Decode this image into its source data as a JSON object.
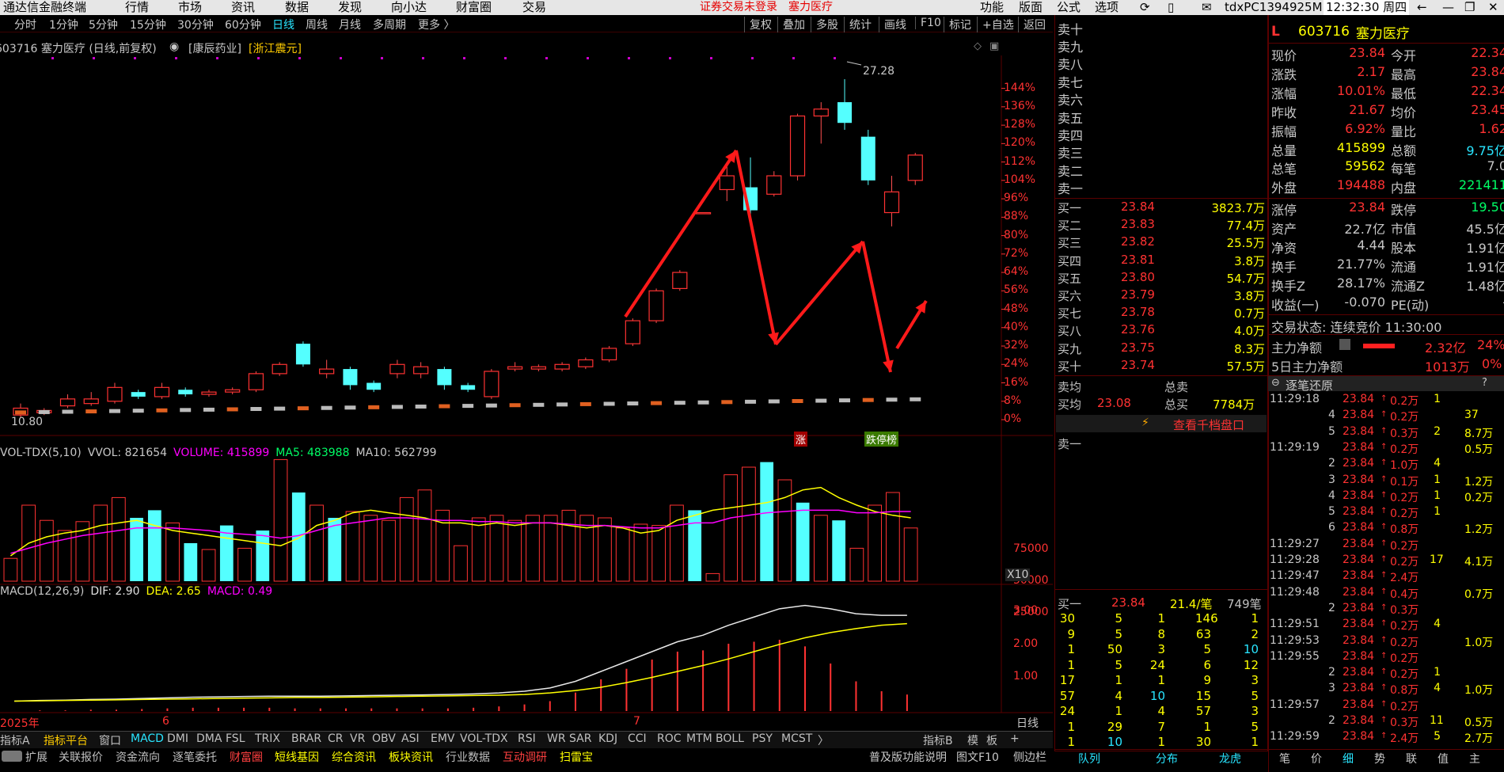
{
  "window": {
    "app_title": "通达信金融终端",
    "menu": [
      "行情",
      "市场",
      "资讯",
      "数据",
      "发现",
      "向小达",
      "财富圈",
      "交易"
    ],
    "notice": "证券交易未登录",
    "notice_stock": "塞力医疗",
    "right_menu": [
      "功能",
      "版面",
      "公式",
      "选项"
    ],
    "user": "tdxPC1394925M",
    "clock": "12:32:30 周四"
  },
  "period_tabs": [
    "分时",
    "1分钟",
    "5分钟",
    "15分钟",
    "30分钟",
    "60分钟",
    "日线",
    "周线",
    "月线",
    "多周期",
    "更多 〉"
  ],
  "active_period": "日线",
  "chart_tools": [
    "复权",
    "叠加",
    "多股",
    "统计",
    "画线",
    "F10",
    "标记",
    "+自选",
    "返回"
  ],
  "chart_header": {
    "code_title": "603716 塞力医疗 (日线,前复权)",
    "concept": "[康辰药业]",
    "region": "[浙江震元]"
  },
  "kline_chart": {
    "high_label": "27.28",
    "low_label": "10.80",
    "y_ticks": [
      "144%",
      "136%",
      "128%",
      "120%",
      "112%",
      "104%",
      "96%",
      "88%",
      "80%",
      "72%",
      "64%",
      "56%",
      "48%",
      "40%",
      "32%",
      "24%",
      "16%",
      "8%",
      "0%"
    ],
    "zhang_label": "涨",
    "diebang_label": "跌",
    "cibang_label": "榜",
    "limit_label": "跌停榜"
  },
  "chart_data": [
    {
      "type": "candlestick",
      "title": "603716 塞力医疗 (日线,前复权)",
      "ylabel": "",
      "y_unit": "% from base",
      "ylim": [
        0,
        148
      ],
      "grid": true,
      "series": [
        {
          "name": "",
          "values": [
            {
              "o": 2,
              "c": 5,
              "h": 7,
              "l": 1,
              "up": true
            },
            {
              "o": 3,
              "c": 4,
              "h": 5,
              "l": 2,
              "up": true
            },
            {
              "o": 6,
              "c": 9,
              "h": 11,
              "l": 5,
              "up": true
            },
            {
              "o": 7,
              "c": 9,
              "h": 12,
              "l": 6,
              "up": true
            },
            {
              "o": 8,
              "c": 14,
              "h": 16,
              "l": 7,
              "up": true
            },
            {
              "o": 12,
              "c": 10,
              "h": 13,
              "l": 9,
              "up": false
            },
            {
              "o": 10,
              "c": 14,
              "h": 16,
              "l": 9,
              "up": true
            },
            {
              "o": 13,
              "c": 11,
              "h": 14,
              "l": 10,
              "up": false
            },
            {
              "o": 11,
              "c": 12,
              "h": 13,
              "l": 10,
              "up": true
            },
            {
              "o": 12,
              "c": 13,
              "h": 14,
              "l": 11,
              "up": true
            },
            {
              "o": 13,
              "c": 20,
              "h": 21,
              "l": 12,
              "up": true
            },
            {
              "o": 20,
              "c": 24,
              "h": 25,
              "l": 19,
              "up": true
            },
            {
              "o": 33,
              "c": 24,
              "h": 34,
              "l": 23,
              "up": false
            },
            {
              "o": 22,
              "c": 20,
              "h": 26,
              "l": 18,
              "up": true
            },
            {
              "o": 22,
              "c": 15,
              "h": 23,
              "l": 13,
              "up": false
            },
            {
              "o": 16,
              "c": 13,
              "h": 17,
              "l": 12,
              "up": false
            },
            {
              "o": 20,
              "c": 24,
              "h": 26,
              "l": 18,
              "up": true
            },
            {
              "o": 20,
              "c": 23,
              "h": 25,
              "l": 18,
              "up": true
            },
            {
              "o": 22,
              "c": 15,
              "h": 23,
              "l": 13,
              "up": false
            },
            {
              "o": 15,
              "c": 13,
              "h": 16,
              "l": 12,
              "up": false
            },
            {
              "o": 10,
              "c": 21,
              "h": 22,
              "l": 9,
              "up": true
            },
            {
              "o": 22,
              "c": 23,
              "h": 25,
              "l": 21,
              "up": true
            },
            {
              "o": 22,
              "c": 23,
              "h": 24,
              "l": 21,
              "up": true
            },
            {
              "o": 22,
              "c": 24,
              "h": 25,
              "l": 21,
              "up": true
            },
            {
              "o": 23,
              "c": 26,
              "h": 27,
              "l": 22,
              "up": true
            },
            {
              "o": 26,
              "c": 31,
              "h": 32,
              "l": 25,
              "up": true
            },
            {
              "o": 33,
              "c": 43,
              "h": 44,
              "l": 32,
              "up": true
            },
            {
              "o": 43,
              "c": 56,
              "h": 57,
              "l": 42,
              "up": true
            },
            {
              "o": 57,
              "c": 64,
              "h": 65,
              "l": 56,
              "up": true
            },
            {
              "o": 90,
              "c": 90,
              "h": 90,
              "l": 90,
              "up": true
            },
            {
              "o": 100,
              "c": 106,
              "h": 112,
              "l": 95,
              "up": true
            },
            {
              "o": 101,
              "c": 91,
              "h": 114,
              "l": 88,
              "up": false
            },
            {
              "o": 98,
              "c": 106,
              "h": 108,
              "l": 97,
              "up": true
            },
            {
              "o": 106,
              "c": 132,
              "h": 133,
              "l": 104,
              "up": true
            },
            {
              "o": 132,
              "c": 135,
              "h": 138,
              "l": 120,
              "up": true
            },
            {
              "o": 138,
              "c": 129,
              "h": 148,
              "l": 126,
              "up": false
            },
            {
              "o": 123,
              "c": 104,
              "h": 126,
              "l": 102,
              "up": false
            },
            {
              "o": 90,
              "c": 99,
              "h": 106,
              "l": 84,
              "up": true
            },
            {
              "o": 104,
              "c": 115,
              "h": 116,
              "l": 102,
              "up": true
            }
          ]
        }
      ]
    },
    {
      "type": "bar",
      "title": "VOL-TDX(5,10)",
      "ylabel": "",
      "ylim": [
        0,
        100000
      ],
      "unit_label": "X10",
      "y_ticks": [
        25000,
        50000,
        75000
      ],
      "series": [
        {
          "name": "VOLUME",
          "values": [
            18000,
            60000,
            48000,
            40000,
            47000,
            60000,
            66000,
            50000,
            56000,
            46000,
            30000,
            25000,
            44000,
            26000,
            40000,
            96000,
            70000,
            60000,
            50000,
            55000,
            52000,
            48000,
            66000,
            72000,
            56000,
            28000,
            50000,
            52000,
            48000,
            52000,
            52000,
            56000,
            52000,
            50000,
            42000,
            45000,
            44000,
            60000,
            56000,
            6000,
            84000,
            90000,
            94000,
            80000,
            62000,
            52000,
            48000,
            26000,
            60000,
            70000,
            42000
          ]
        },
        {
          "name": "MA5",
          "values": [
            20000,
            30000,
            35000,
            38000,
            40000,
            44000,
            46000,
            48000,
            44000,
            40000,
            38000,
            36000,
            34000,
            32000,
            30000,
            28000,
            34000,
            44000,
            48000,
            54000,
            56000,
            54000,
            52000,
            50000,
            46000,
            46000,
            44000,
            46000,
            44000,
            46000,
            46000,
            44000,
            42000,
            44000,
            42000,
            38000,
            40000,
            48000,
            52000,
            56000,
            58000,
            60000,
            62000,
            66000,
            72000,
            74000,
            66000,
            60000,
            55000,
            52000,
            50000
          ]
        },
        {
          "name": "MA10",
          "values": [
            22000,
            26000,
            30000,
            33000,
            36000,
            38000,
            40000,
            42000,
            42000,
            42000,
            41000,
            40000,
            38000,
            37000,
            36000,
            34000,
            36000,
            40000,
            44000,
            46000,
            48000,
            50000,
            50000,
            49000,
            48000,
            48000,
            47000,
            47000,
            46000,
            46000,
            46000,
            45000,
            44000,
            44000,
            43000,
            42000,
            42000,
            44000,
            46000,
            46000,
            50000,
            52000,
            54000,
            55000,
            56000,
            56000,
            56000,
            54000,
            54000,
            55000,
            55000
          ]
        }
      ],
      "legend": {
        "vvol": "VVOL: 821654",
        "volume": "VOLUME: 415899",
        "ma5": "MA5: 483988",
        "ma10": "MA10: 562799"
      }
    },
    {
      "type": "line",
      "title": "MACD(12,26,9)",
      "ylabel": "",
      "ylim": [
        0,
        3.6
      ],
      "y_ticks": [
        1.0,
        2.0,
        3.0
      ],
      "series": [
        {
          "name": "DIF",
          "values": [
            0.3,
            0.32,
            0.33,
            0.35,
            0.36,
            0.38,
            0.4,
            0.42,
            0.43,
            0.44,
            0.45,
            0.45,
            0.45,
            0.46,
            0.47,
            0.48,
            0.49,
            0.5,
            0.52,
            0.55,
            0.6,
            0.7,
            0.9,
            1.2,
            1.5,
            1.8,
            2.1,
            2.3,
            2.6,
            2.85,
            3.1,
            3.2,
            3.1,
            2.95,
            2.9,
            2.9
          ]
        },
        {
          "name": "DEA",
          "values": [
            0.3,
            0.31,
            0.32,
            0.33,
            0.34,
            0.35,
            0.36,
            0.37,
            0.38,
            0.39,
            0.4,
            0.41,
            0.41,
            0.42,
            0.43,
            0.44,
            0.45,
            0.46,
            0.47,
            0.48,
            0.5,
            0.55,
            0.62,
            0.72,
            0.86,
            1.02,
            1.2,
            1.38,
            1.58,
            1.8,
            2.02,
            2.22,
            2.38,
            2.5,
            2.6,
            2.65
          ]
        }
      ],
      "legend": {
        "dif": "DIF: 2.90",
        "dea": "DEA: 2.65",
        "macd": "MACD: 0.49"
      }
    }
  ],
  "x_axis_labels": [
    "2025年",
    "6",
    "7"
  ],
  "period_axis_label": "日线",
  "order_book": {
    "sell_label": "卖十",
    "sells": [
      "卖九",
      "卖八",
      "卖七",
      "卖六",
      "卖五",
      "卖四",
      "卖三",
      "卖二",
      "卖一"
    ],
    "buys": [
      {
        "label": "买一",
        "price": "23.84",
        "vol": "3823.7万"
      },
      {
        "label": "买二",
        "price": "23.83",
        "vol": "77.4万"
      },
      {
        "label": "买三",
        "price": "23.82",
        "vol": "25.5万"
      },
      {
        "label": "买四",
        "price": "23.81",
        "vol": "3.8万"
      },
      {
        "label": "买五",
        "price": "23.80",
        "vol": "54.7万"
      },
      {
        "label": "买六",
        "price": "23.79",
        "vol": "3.8万"
      },
      {
        "label": "买七",
        "price": "23.78",
        "vol": "0.7万"
      },
      {
        "label": "买八",
        "price": "23.76",
        "vol": "4.0万"
      },
      {
        "label": "买九",
        "price": "23.75",
        "vol": "8.3万"
      },
      {
        "label": "买十",
        "price": "23.74",
        "vol": "57.5万"
      }
    ],
    "sell_avg_label": "卖均",
    "sell_total_label": "总卖",
    "buy_avg_label": "买均",
    "buy_avg": "23.08",
    "buy_total_label": "总买",
    "buy_total": "7784万",
    "view_thousand": "查看千档盘口",
    "sell1_label": "卖一",
    "buy1_label": "买一",
    "buy1_price": "23.84",
    "buy1_per": "21.4/笔",
    "buy1_count": "749笔",
    "queue": [
      [
        "30",
        "5",
        "1",
        "146",
        "1"
      ],
      [
        "9",
        "5",
        "8",
        "63",
        "2"
      ],
      [
        "1",
        "50",
        "3",
        "5",
        "10"
      ],
      [
        "1",
        "5",
        "24",
        "6",
        "12"
      ],
      [
        "17",
        "1",
        "1",
        "9",
        "3"
      ],
      [
        "57",
        "4",
        "10",
        "15",
        "5"
      ],
      [
        "24",
        "1",
        "4",
        "57",
        "3"
      ],
      [
        "1",
        "29",
        "7",
        "1",
        "5"
      ],
      [
        "1",
        "10",
        "1",
        "30",
        "1"
      ]
    ],
    "bottom_tabs": [
      "队列",
      "分布",
      "龙虎"
    ]
  },
  "quote": {
    "flag": "L",
    "code": "603716",
    "name": "塞力医疗",
    "rows": [
      {
        "k1": "现价",
        "v1": "23.84",
        "k2": "今开",
        "v2": "22.34"
      },
      {
        "k1": "涨跌",
        "v1": "2.17",
        "k2": "最高",
        "v2": "23.84"
      },
      {
        "k1": "涨幅",
        "v1": "10.01%",
        "k2": "最低",
        "v2": "22.34"
      },
      {
        "k1": "昨收",
        "v1": "21.67",
        "k2": "均价",
        "v2": "23.45"
      },
      {
        "k1": "振幅",
        "v1": "6.92%",
        "k2": "量比",
        "v2": "1.62"
      },
      {
        "k1": "总量",
        "v1": "415899",
        "k2": "总额",
        "v2": "9.75亿"
      },
      {
        "k1": "总笔",
        "v1": "59562",
        "k2": "每笔",
        "v2": "7.0"
      },
      {
        "k1": "外盘",
        "v1": "194488",
        "k2": "内盘",
        "v2": "221411"
      }
    ],
    "rows2": [
      {
        "k1": "涨停",
        "v1": "23.84",
        "k2": "跌停",
        "v2": "19.50"
      },
      {
        "k1": "资产",
        "v1": "22.7亿",
        "k2": "市值",
        "v2": "45.5亿"
      },
      {
        "k1": "净资",
        "v1": "4.44",
        "k2": "股本",
        "v2": "1.91亿"
      },
      {
        "k1": "换手",
        "v1": "21.77%",
        "k2": "流通",
        "v2": "1.91亿"
      },
      {
        "k1": "换手Z",
        "v1": "28.17%",
        "k2": "流通Z",
        "v2": "1.48亿"
      },
      {
        "k1": "收益(一)",
        "v1": "-0.070",
        "k2": "PE(动)",
        "v2": "-"
      }
    ],
    "trade_status": "交易状态: 连续竞价 11:30:00",
    "main_net_label": "主力净额",
    "main_net": "2.32亿",
    "main_net_pct": "24%",
    "main5_label": "5日主力净额",
    "main5": "1013万",
    "main5_pct": "0%",
    "tick_title": "逐笔还原",
    "ticks": [
      [
        "11:29:18",
        "23.84",
        "0.2万",
        "1",
        ""
      ],
      [
        "4",
        "23.84",
        "0.2万",
        "",
        "37"
      ],
      [
        "5",
        "23.84",
        "0.3万",
        "2",
        "8.7万"
      ],
      [
        "11:29:19",
        "23.84",
        "0.2万",
        "",
        "0.5万"
      ],
      [
        "2",
        "23.84",
        "1.0万",
        "4",
        ""
      ],
      [
        "3",
        "23.84",
        "0.1万",
        "1",
        "1.2万"
      ],
      [
        "4",
        "23.84",
        "0.2万",
        "1",
        "0.2万"
      ],
      [
        "5",
        "23.84",
        "0.2万",
        "1",
        ""
      ],
      [
        "6",
        "23.84",
        "0.8万",
        "",
        "1.2万"
      ],
      [
        "11:29:27",
        "23.84",
        "0.2万",
        "",
        ""
      ],
      [
        "11:29:28",
        "23.84",
        "0.2万",
        "17",
        "4.1万"
      ],
      [
        "11:29:47",
        "23.84",
        "2.4万",
        "",
        ""
      ],
      [
        "11:29:48",
        "23.84",
        "0.4万",
        "",
        "0.7万"
      ],
      [
        "2",
        "23.84",
        "0.3万",
        "",
        ""
      ],
      [
        "11:29:51",
        "23.84",
        "0.2万",
        "4",
        ""
      ],
      [
        "11:29:53",
        "23.84",
        "0.2万",
        "",
        "1.0万"
      ],
      [
        "11:29:55",
        "23.84",
        "0.2万",
        "",
        ""
      ],
      [
        "2",
        "23.84",
        "0.2万",
        "1",
        ""
      ],
      [
        "3",
        "23.84",
        "0.8万",
        "4",
        "1.0万"
      ],
      [
        "11:29:57",
        "23.84",
        "0.2万",
        "",
        ""
      ],
      [
        "2",
        "23.84",
        "0.3万",
        "11",
        "0.5万"
      ],
      [
        "11:29:59",
        "23.84",
        "2.4万",
        "5",
        "2.7万"
      ]
    ],
    "bottom_tabs": [
      "笔",
      "价",
      "细",
      "势",
      "联",
      "值",
      "主"
    ]
  },
  "indicator_tabs": [
    "指标A",
    "指标平台",
    "窗口",
    "MACD",
    "DMI",
    "DMA",
    "FSL",
    "TRIX",
    "BRAR",
    "CR",
    "VR",
    "OBV",
    "ASI",
    "EMV",
    "VOL-TDX",
    "RSI",
    "WR",
    "SAR",
    "KDJ",
    "CCI",
    "ROC",
    "MTM",
    "BOLL",
    "PSY",
    "MCST",
    "〉"
  ],
  "indicator_right": [
    "指标B",
    "模",
    "板",
    "+"
  ],
  "bottom_links": [
    "扩展",
    "关联报价",
    "资金流向",
    "逐笔委托",
    "财富圈",
    "短线基因",
    "综合资讯",
    "板块资讯",
    "行业数据",
    "互动调研",
    "扫雷宝"
  ],
  "status_right": "普及版功能说明",
  "status_right2": "图文F10",
  "status_right3": "侧边栏",
  "colors": {
    "up": "#ff3232",
    "down": "#54ffff",
    "flat": "#c0c0c0",
    "yellow": "#ffff00",
    "magenta": "#ff00ff",
    "accent_blue": "#29e5ff",
    "grid": "#5a0000"
  }
}
